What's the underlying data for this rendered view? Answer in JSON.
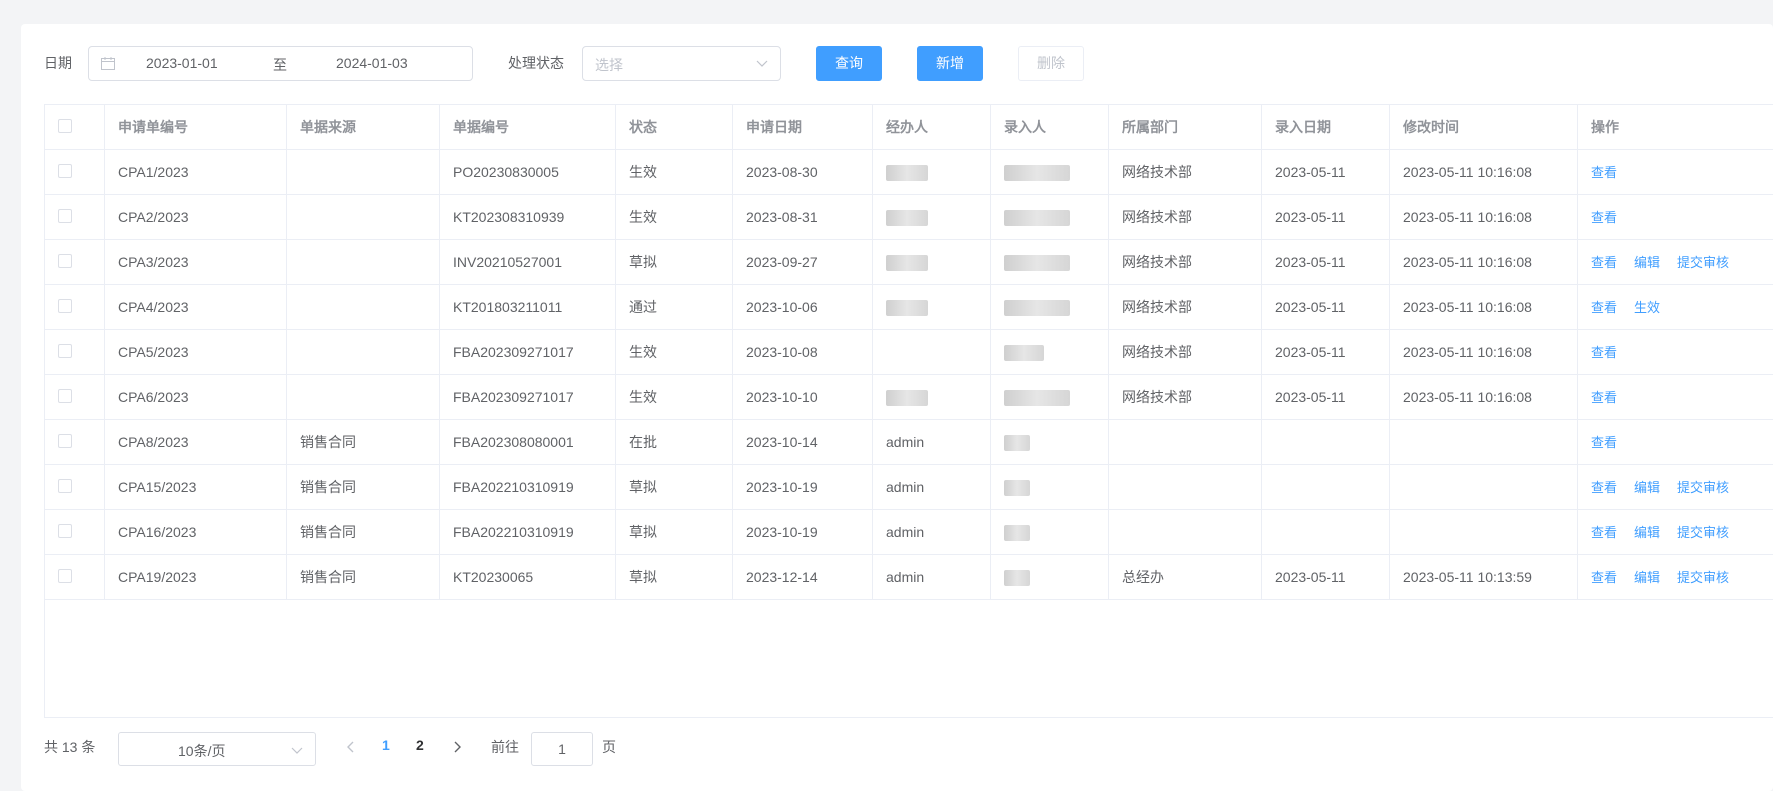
{
  "filter": {
    "date_label": "日期",
    "date_start": "2023-01-01",
    "date_sep": "至",
    "date_end": "2024-01-03",
    "status_label": "处理状态",
    "status_placeholder": "选择",
    "query_button": "查询",
    "add_button": "新增",
    "delete_button": "删除"
  },
  "table": {
    "headers": [
      "申请单编号",
      "单据来源",
      "单据编号",
      "状态",
      "申请日期",
      "经办人",
      "录入人",
      "所属部门",
      "录入日期",
      "修改时间",
      "操作"
    ],
    "rows": [
      {
        "no": "CPA1/2023",
        "source": "",
        "doc": "PO20230830005",
        "status": "生效",
        "apply_date": "2023-08-30",
        "handler": "",
        "entry": "",
        "dept": "网络技术部",
        "entry_date": "2023-05-11",
        "modified": "2023-05-11 10:16:08",
        "ops": [
          "查看"
        ]
      },
      {
        "no": "CPA2/2023",
        "source": "",
        "doc": "KT202308310939",
        "status": "生效",
        "apply_date": "2023-08-31",
        "handler": "",
        "entry": "",
        "dept": "网络技术部",
        "entry_date": "2023-05-11",
        "modified": "2023-05-11 10:16:08",
        "ops": [
          "查看"
        ]
      },
      {
        "no": "CPA3/2023",
        "source": "",
        "doc": "INV20210527001",
        "status": "草拟",
        "apply_date": "2023-09-27",
        "handler": "",
        "entry": "",
        "dept": "网络技术部",
        "entry_date": "2023-05-11",
        "modified": "2023-05-11 10:16:08",
        "ops": [
          "查看",
          "编辑",
          "提交审核"
        ]
      },
      {
        "no": "CPA4/2023",
        "source": "",
        "doc": "KT201803211011",
        "status": "通过",
        "apply_date": "2023-10-06",
        "handler": "",
        "entry": "",
        "dept": "网络技术部",
        "entry_date": "2023-05-11",
        "modified": "2023-05-11 10:16:08",
        "ops": [
          "查看",
          "生效"
        ]
      },
      {
        "no": "CPA5/2023",
        "source": "",
        "doc": "FBA202309271017",
        "status": "生效",
        "apply_date": "2023-10-08",
        "handler": "",
        "entry": "",
        "dept": "网络技术部",
        "entry_date": "2023-05-11",
        "modified": "2023-05-11 10:16:08",
        "ops": [
          "查看"
        ]
      },
      {
        "no": "CPA6/2023",
        "source": "",
        "doc": "FBA202309271017",
        "status": "生效",
        "apply_date": "2023-10-10",
        "handler": "",
        "entry": "",
        "dept": "网络技术部",
        "entry_date": "2023-05-11",
        "modified": "2023-05-11 10:16:08",
        "ops": [
          "查看"
        ]
      },
      {
        "no": "CPA8/2023",
        "source": "销售合同",
        "doc": "FBA202308080001",
        "status": "在批",
        "apply_date": "2023-10-14",
        "handler": "admin",
        "entry": "",
        "dept": "",
        "entry_date": "",
        "modified": "",
        "ops": [
          "查看"
        ]
      },
      {
        "no": "CPA15/2023",
        "source": "销售合同",
        "doc": "FBA202210310919",
        "status": "草拟",
        "apply_date": "2023-10-19",
        "handler": "admin",
        "entry": "",
        "dept": "",
        "entry_date": "",
        "modified": "",
        "ops": [
          "查看",
          "编辑",
          "提交审核"
        ]
      },
      {
        "no": "CPA16/2023",
        "source": "销售合同",
        "doc": "FBA202210310919",
        "status": "草拟",
        "apply_date": "2023-10-19",
        "handler": "admin",
        "entry": "",
        "dept": "",
        "entry_date": "",
        "modified": "",
        "ops": [
          "查看",
          "编辑",
          "提交审核"
        ]
      },
      {
        "no": "CPA19/2023",
        "source": "销售合同",
        "doc": "KT20230065",
        "status": "草拟",
        "apply_date": "2023-12-14",
        "handler": "admin",
        "entry": "",
        "dept": "总经办",
        "entry_date": "2023-05-11",
        "modified": "2023-05-11 10:13:59",
        "ops": [
          "查看",
          "编辑",
          "提交审核"
        ]
      }
    ]
  },
  "pagination": {
    "total": "共 13 条",
    "page_size": "10条/页",
    "pages": [
      "1",
      "2"
    ],
    "current": "1",
    "goto_label": "前往",
    "goto_value": "1",
    "page_suffix": "页"
  },
  "colors": {
    "primary": "#409eff",
    "border": "#ebeef5",
    "text": "#606266"
  }
}
